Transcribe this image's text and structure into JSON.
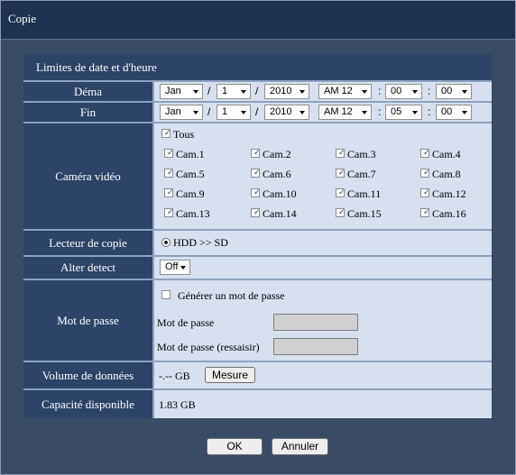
{
  "window": {
    "title": "Copie"
  },
  "section": {
    "title": "Limites de date et d'heure"
  },
  "start": {
    "label": "Déma",
    "month": "Jan",
    "day": "1",
    "year": "2010",
    "hour": "AM 12",
    "minute": "00",
    "second": "00"
  },
  "end": {
    "label": "Fin",
    "month": "Jan",
    "day": "1",
    "year": "2010",
    "hour": "AM 12",
    "minute": "05",
    "second": "00"
  },
  "date_sep": "/",
  "time_sep": ":",
  "camera": {
    "label": "Caméra vidéo",
    "all_label": "Tous",
    "all_checked": true,
    "cams": [
      "Cam.1",
      "Cam.2",
      "Cam.3",
      "Cam.4",
      "Cam.5",
      "Cam.6",
      "Cam.7",
      "Cam.8",
      "Cam.9",
      "Cam.10",
      "Cam.11",
      "Cam.12",
      "Cam.13",
      "Cam.14",
      "Cam.15",
      "Cam.16"
    ]
  },
  "drive": {
    "label": "Lecteur de copie",
    "option": "HDD >> SD"
  },
  "alter": {
    "label": "Alter detect",
    "value": "Off"
  },
  "password": {
    "label": "Mot de passe",
    "generate_label": "Générer un mot de passe",
    "generate_checked": false,
    "pw_label": "Mot de passe",
    "pw_confirm_label": "Mot de passe (ressaisir)"
  },
  "volume": {
    "label": "Volume de données",
    "value": "-.-- GB",
    "button": "Mesure"
  },
  "capacity": {
    "label": "Capacité disponible",
    "value": "1.83 GB"
  },
  "buttons": {
    "ok": "OK",
    "cancel": "Annuler"
  },
  "colors": {
    "title_bar": "#1f3350",
    "label_bg": "#2d4466",
    "value_bg": "#d6e0ee",
    "frame_bg": "#3a4c64"
  }
}
